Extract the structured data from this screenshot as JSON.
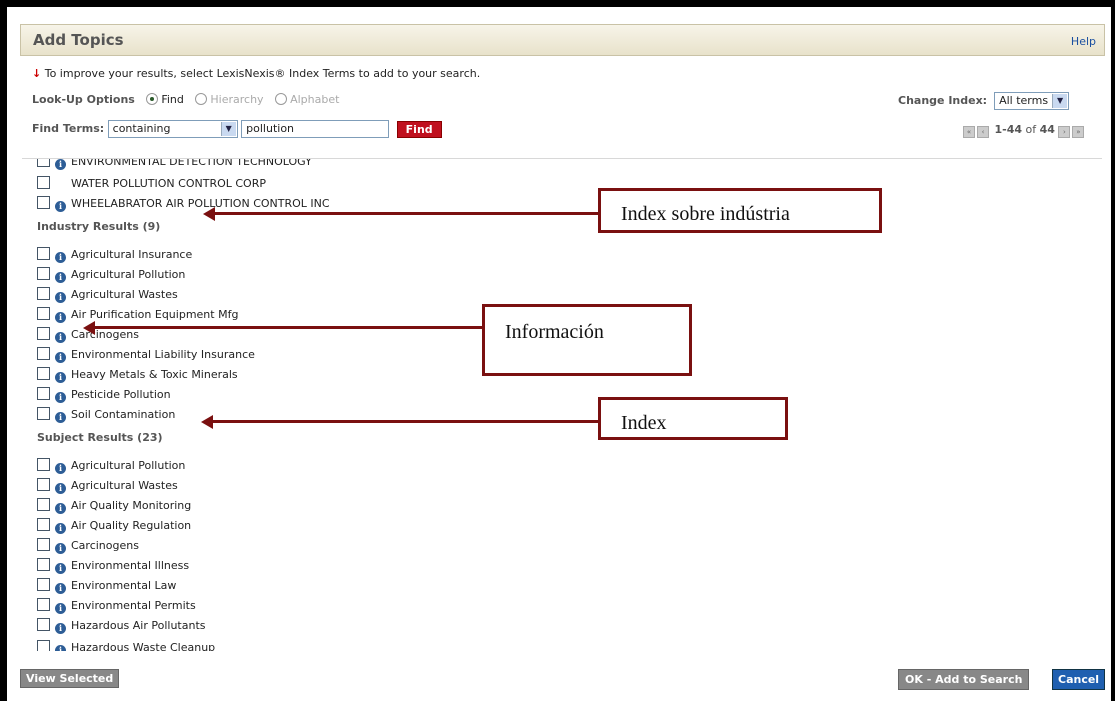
{
  "dialog": {
    "title": "Add Topics",
    "help": "Help"
  },
  "tip": "To improve your results, select LexisNexis® Index Terms to add to your search.",
  "lookup": {
    "label": "Look-Up Options",
    "options": [
      "Find",
      "Hierarchy",
      "Alphabet"
    ],
    "selected": "Find"
  },
  "change_index": {
    "label": "Change Index:",
    "value": "All terms"
  },
  "find_terms": {
    "label": "Find Terms:",
    "mode": "containing",
    "query": "pollution",
    "button": "Find"
  },
  "pager": {
    "range": "1-44",
    "of": "of",
    "total": "44"
  },
  "company_rows": [
    {
      "label": "ENVIRONMENTAL DETECTION TECHNOLOGY",
      "info": true
    },
    {
      "label": "WATER POLLUTION CONTROL CORP",
      "info": false
    },
    {
      "label": "WHEELABRATOR AIR POLLUTION CONTROL INC",
      "info": true
    }
  ],
  "industry_section": "Industry Results (9)",
  "industry_rows": [
    "Agricultural Insurance",
    "Agricultural Pollution",
    "Agricultural Wastes",
    "Air Purification Equipment Mfg",
    "Carcinogens",
    "Environmental Liability Insurance",
    "Heavy Metals & Toxic Minerals",
    "Pesticide Pollution",
    "Soil Contamination"
  ],
  "subject_section": "Subject Results (23)",
  "subject_rows": [
    "Agricultural Pollution",
    "Agricultural Wastes",
    "Air Quality Monitoring",
    "Air Quality Regulation",
    "Carcinogens",
    "Environmental Illness",
    "Environmental Law",
    "Environmental Permits",
    "Hazardous Air Pollutants",
    "Hazardous Waste Cleanup"
  ],
  "buttons": {
    "view_selected": "View Selected",
    "ok": "OK - Add to Search",
    "cancel": "Cancel"
  },
  "annotations": {
    "industry": "Index sobre indústria",
    "information": "Información",
    "index": "Index"
  },
  "colors": {
    "find_button": "#c0101e",
    "cancel_button": "#1f5fb0",
    "annotation": "#7a1010"
  }
}
